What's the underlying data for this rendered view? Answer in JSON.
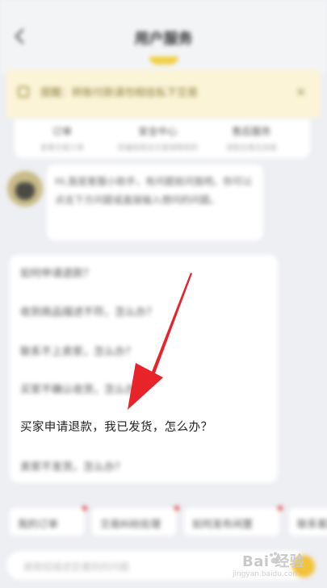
{
  "header": {
    "title": "用户服务"
  },
  "notice": {
    "text": "提醒：转账付款请勿相信私下交易"
  },
  "shortcuts": [
    {
      "label": "订单",
      "sub": "查看交易订单"
    },
    {
      "label": "安全中心",
      "sub": "防骗指南及交易保障规则"
    },
    {
      "label": "售后服务",
      "sub": "退款及售后进度"
    }
  ],
  "bot": {
    "greeting": "Hi,我是客服小助手，有问题就问我吧。你可以点击下方问题或直接输入想问的问题。"
  },
  "faq": {
    "items": [
      "如何申请退款？",
      "收到商品描述不符，怎么办？",
      "联系不上卖家，怎么办？",
      "买家不确认收货，怎么办？",
      "买家申请退款，我已发货，怎么办？",
      "卖家不发货，怎么办？"
    ]
  },
  "quick_chips": [
    "我的订单",
    "交易纠纷处理",
    "如何发布闲置",
    "联系客服"
  ],
  "input": {
    "placeholder": "请简短描述您遇到的问题"
  },
  "watermark": {
    "brand": "Bai 经验",
    "sub": "jingyan.baidu.com"
  },
  "colors": {
    "accent": "#f2c33a",
    "annotation_arrow": "#e8232a",
    "notice_bg": "#fbf4d6"
  }
}
